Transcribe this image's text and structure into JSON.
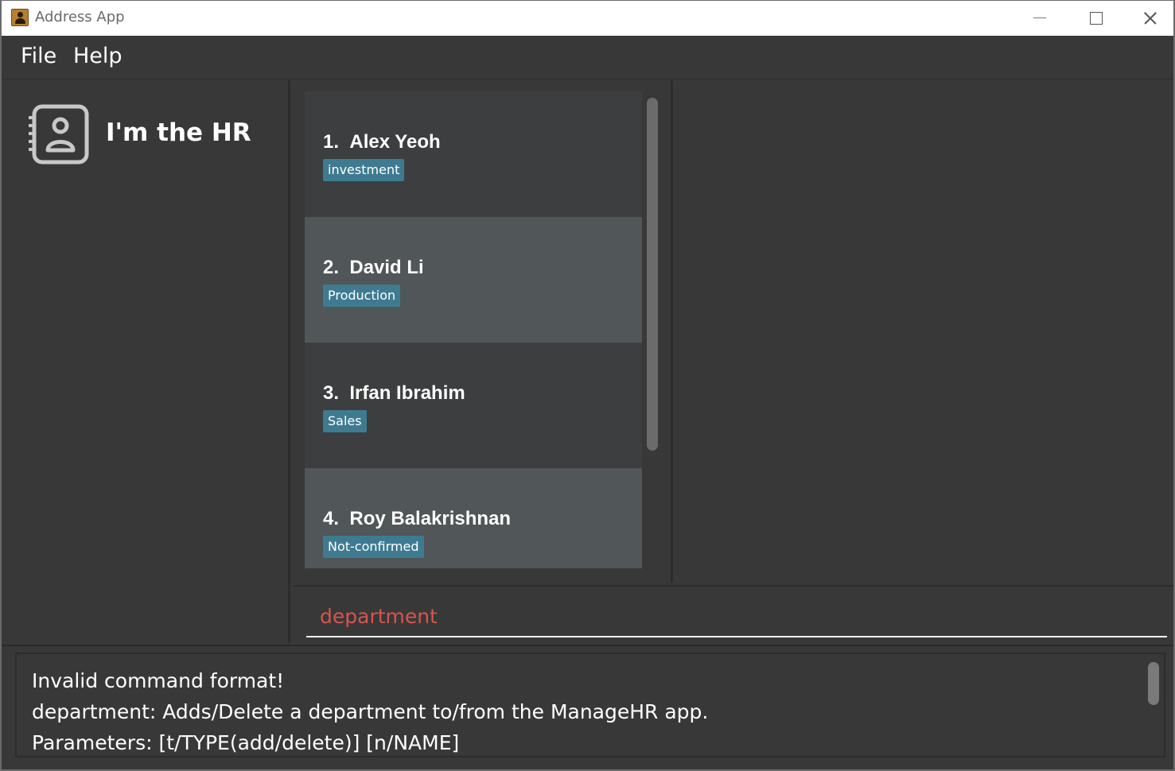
{
  "window": {
    "title": "Address App",
    "app_icon": "address-book-icon"
  },
  "menu": {
    "file_label": "File",
    "help_label": "Help"
  },
  "sidebar": {
    "logo_icon": "contact-book-icon",
    "title": "I'm the HR"
  },
  "persons": [
    {
      "index": "1.",
      "name": "Alex Yeoh",
      "tag": "investment"
    },
    {
      "index": "2.",
      "name": "David Li",
      "tag": "Production"
    },
    {
      "index": "3.",
      "name": "Irfan Ibrahim",
      "tag": "Sales"
    },
    {
      "index": "4.",
      "name": "Roy Balakrishnan",
      "tag": "Not-confirmed"
    }
  ],
  "command": {
    "value": "department"
  },
  "result": {
    "lines": [
      "Invalid command format!",
      "department: Adds/Delete a department to/from the ManageHR app.",
      "Parameters: [t/TYPE(add/delete)] [n/NAME]"
    ]
  },
  "colors": {
    "background": "#383838",
    "card_odd": "#3c3e3f",
    "card_even": "#515658",
    "tag": "#3e7b91",
    "command_error_text": "#d6554f"
  }
}
